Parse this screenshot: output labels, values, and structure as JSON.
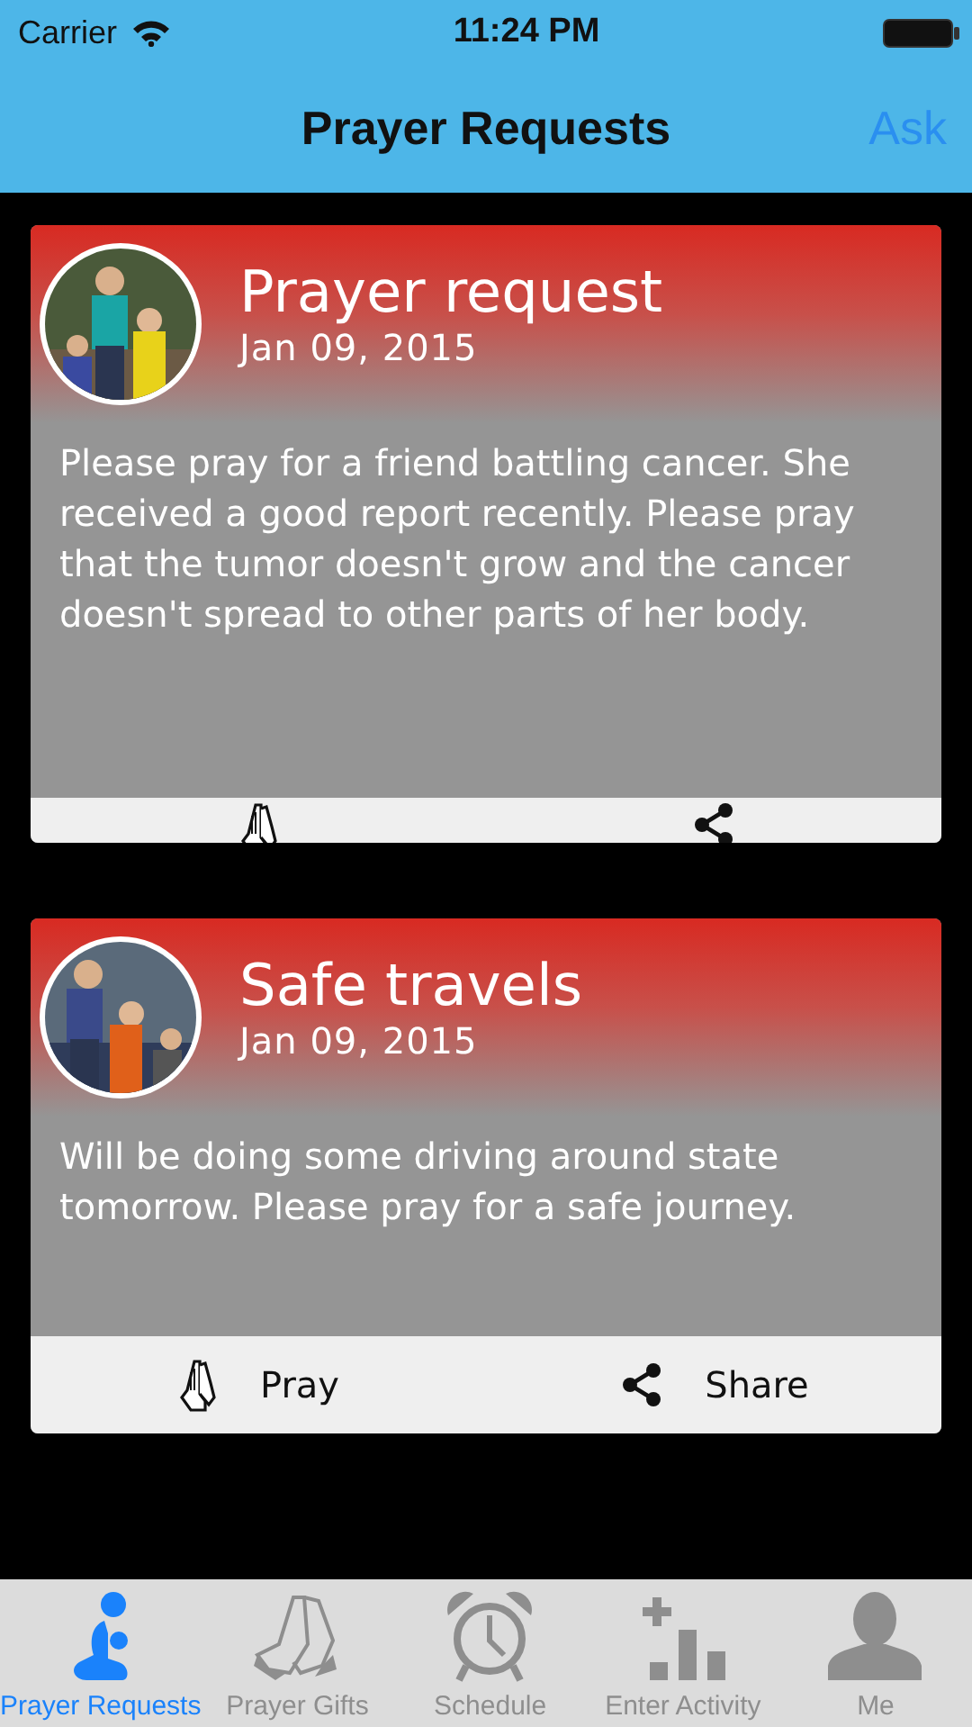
{
  "status_bar": {
    "carrier": "Carrier",
    "time": "11:24 PM"
  },
  "nav": {
    "title": "Prayer Requests",
    "action": "Ask"
  },
  "cards": [
    {
      "title": "Prayer request",
      "date": "Jan 09, 2015",
      "body": "Please pray for a friend battling cancer. She received a good report recently. Please pray that the tumor doesn't grow and the cancer doesn't spread to other parts of her body.",
      "clipped": true,
      "actions": [
        {
          "kind": "pray"
        },
        {
          "kind": "share"
        }
      ]
    },
    {
      "title": "Safe travels",
      "date": "Jan 09, 2015",
      "body": "Will be doing some driving around state tomorrow. Please pray for a safe journey.",
      "clipped": false,
      "actions": [
        {
          "kind": "pray",
          "label": "Pray"
        },
        {
          "kind": "share",
          "label": "Share"
        }
      ]
    }
  ],
  "tabs": [
    {
      "kind": "kneel",
      "label": "Prayer Requests",
      "selected": true
    },
    {
      "kind": "hands",
      "label": "Prayer Gifts",
      "selected": false
    },
    {
      "kind": "clock",
      "label": "Schedule",
      "selected": false
    },
    {
      "kind": "activity",
      "label": "Enter Activity",
      "selected": false
    },
    {
      "kind": "person",
      "label": "Me",
      "selected": false
    }
  ]
}
